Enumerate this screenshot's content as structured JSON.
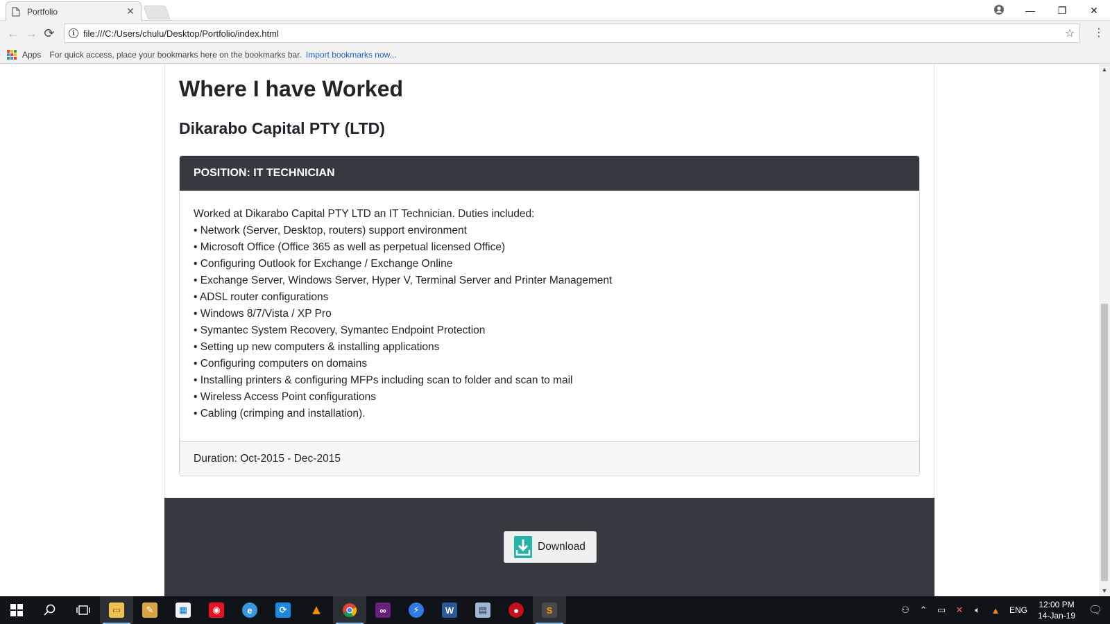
{
  "browser": {
    "tab_title": "Portfolio",
    "url": "file:///C:/Users/chulu/Desktop/Portfolio/index.html",
    "bookmarks": {
      "apps_label": "Apps",
      "hint": "For quick access, place your bookmarks here on the bookmarks bar.",
      "import_link": "Import bookmarks now..."
    }
  },
  "page": {
    "section_title": "Where I have Worked",
    "company": "Dikarabo Capital PTY (LTD)",
    "card": {
      "header": "POSITION: IT TECHNICIAN",
      "intro": "Worked at Dikarabo Capital PTY LTD an IT Technician. Duties included:",
      "duties": [
        "• Network (Server, Desktop, routers) support environment",
        "• Microsoft Office (Office 365 as well as perpetual licensed Office)",
        "• Configuring Outlook for Exchange / Exchange Online",
        "• Exchange Server, Windows Server, Hyper V, Terminal Server and Printer Management",
        "• ADSL router configurations",
        "• Windows 8/7/Vista / XP Pro",
        "• Symantec System Recovery, Symantec Endpoint Protection",
        "• Setting up new computers & installing applications",
        "• Configuring computers on domains",
        "• Installing printers & configuring MFPs including scan to folder and scan to mail",
        "• Wireless Access Point configurations",
        "• Cabling (crimping and installation)."
      ],
      "footer": "Duration: Oct-2015 - Dec-2015"
    },
    "download_label": "Download"
  },
  "taskbar": {
    "language": "ENG",
    "time": "12:00 PM",
    "date": "14-Jan-19"
  },
  "colors": {
    "dark_header": "#343a40",
    "link_blue": "#1a5fd1",
    "download_teal": "#26b3a8",
    "taskbar_bg": "#101418"
  }
}
